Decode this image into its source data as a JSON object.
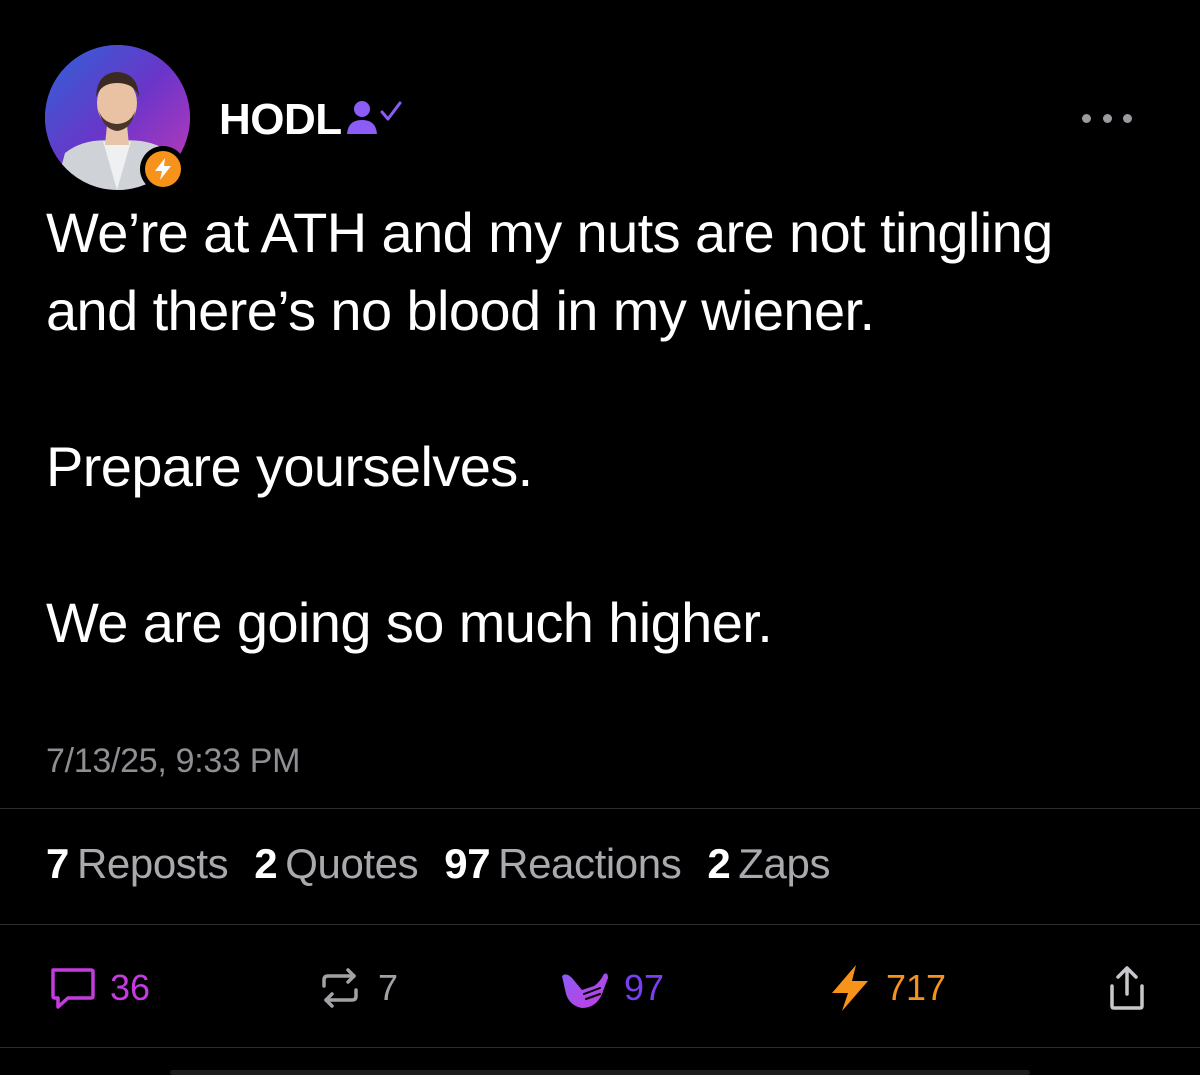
{
  "post": {
    "author": "HODL",
    "paragraphs": [
      "We’re at ATH and my nuts are not tingling\nand there’s no blood in my wiener.",
      "Prepare yourselves.",
      "We are going so much higher."
    ],
    "timestamp": "7/13/25, 9:33 PM"
  },
  "stats": [
    {
      "count": "7",
      "label": "Reposts"
    },
    {
      "count": "2",
      "label": "Quotes"
    },
    {
      "count": "97",
      "label": "Reactions"
    },
    {
      "count": "2",
      "label": "Zaps"
    }
  ],
  "actions": {
    "reply": {
      "count": "36",
      "icon": "reply-icon",
      "color": "#c43ce0"
    },
    "repost": {
      "count": "7",
      "icon": "repost-icon",
      "color": "#a1a1a6"
    },
    "react": {
      "count": "97",
      "icon": "shaka-icon",
      "color": "#7b3ff2"
    },
    "zap": {
      "count": "717",
      "icon": "zap-icon",
      "color": "#f7931a"
    },
    "share": {
      "icon": "share-icon",
      "color": "#c7c7cc"
    }
  },
  "colors": {
    "background": "#000000",
    "text": "#ffffff",
    "muted": "#8e8e93",
    "verified": "#8b5cf6",
    "zap": "#f7931a"
  }
}
